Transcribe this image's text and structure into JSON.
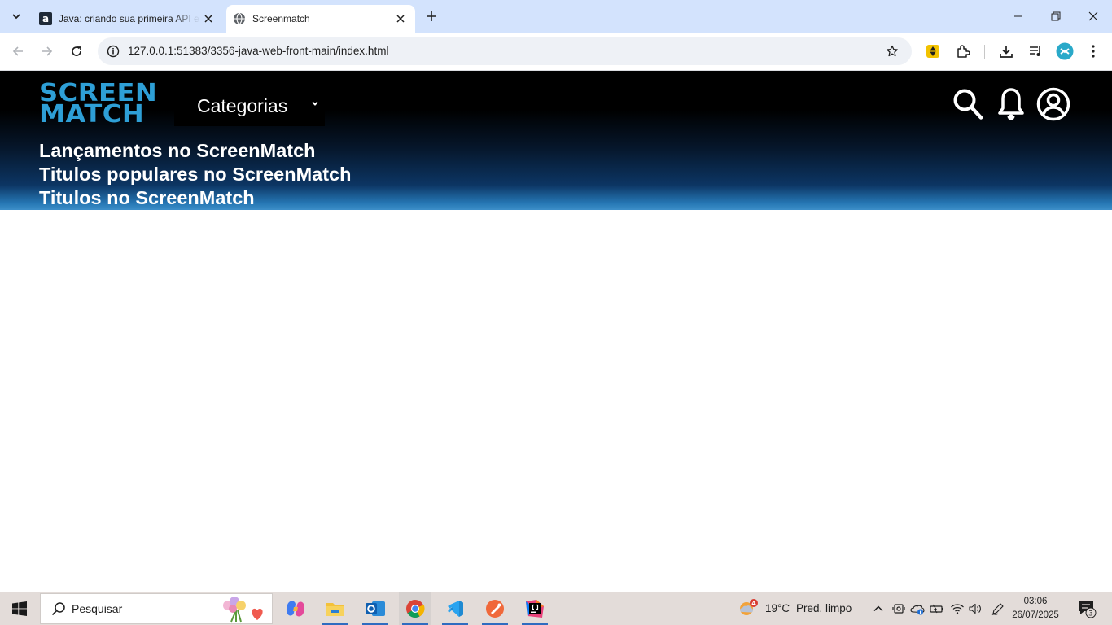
{
  "browser": {
    "tabs": [
      {
        "title": "Java: criando sua primeira API e",
        "favicon": "alura-a-icon",
        "active": false
      },
      {
        "title": "Screenmatch",
        "favicon": "globe-icon",
        "active": true
      }
    ],
    "url": "127.0.0.1:51383/3356-java-web-front-main/index.html"
  },
  "page": {
    "logo": {
      "line1": "SCREEN",
      "line2": "MATCH"
    },
    "category_select": {
      "label": "Categorias"
    },
    "nav_links": [
      "Lançamentos no ScreenMatch",
      "Titulos populares no ScreenMatch",
      "Titulos no ScreenMatch"
    ],
    "header_icons": [
      "search-icon",
      "bell-icon",
      "user-icon"
    ],
    "colors": {
      "logo": "#2e9fd6",
      "header_top": "#000000",
      "header_bottom": "#3d8fc9"
    }
  },
  "taskbar": {
    "search_placeholder": "Pesquisar",
    "apps": [
      "copilot-icon",
      "file-explorer-icon",
      "outlook-icon",
      "chrome-icon",
      "vscode-icon",
      "postman-icon",
      "intellij-icon"
    ],
    "weather": {
      "badge": "4",
      "temp": "19°C",
      "desc": "Pred. limpo"
    },
    "time": "03:06",
    "date": "26/07/2025",
    "notifications": "3"
  }
}
